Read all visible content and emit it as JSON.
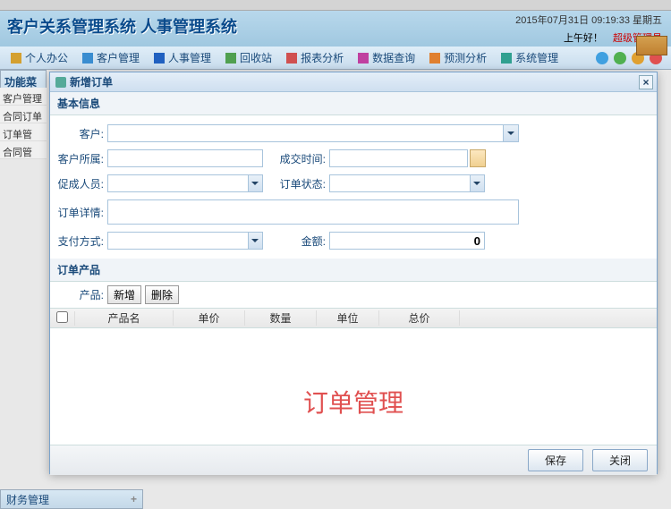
{
  "header": {
    "title": "客户关系管理系统 人事管理系统",
    "datetime": "2015年07月31日 09:19:33 星期五",
    "greeting": "上午好！",
    "admin": "超级管理员"
  },
  "menu": [
    {
      "label": "个人办公",
      "color": "#d4a030"
    },
    {
      "label": "客户管理",
      "color": "#3a8dd0"
    },
    {
      "label": "人事管理",
      "color": "#2060c0"
    },
    {
      "label": "回收站",
      "color": "#50a050"
    },
    {
      "label": "报表分析",
      "color": "#d05050"
    },
    {
      "label": "数据查询",
      "color": "#c040a0"
    },
    {
      "label": "预测分析",
      "color": "#e08030"
    },
    {
      "label": "系统管理",
      "color": "#30a090"
    }
  ],
  "sidebar": {
    "title": "功能菜单",
    "items": [
      "客户管理",
      "合同订单",
      "订单管",
      "合同管"
    ],
    "bottom": "财务管理"
  },
  "dialog": {
    "title": "新增订单",
    "section_basic": "基本信息",
    "labels": {
      "customer": "客户:",
      "belong": "客户所属:",
      "dealtime": "成交时间:",
      "facilitator": "促成人员:",
      "status": "订单状态:",
      "detail": "订单详情:",
      "paytype": "支付方式:",
      "amount": "金额:"
    },
    "amount_value": "0",
    "section_prod": "订单产品",
    "prod_label": "产品:",
    "btn_add": "新增",
    "btn_del": "删除",
    "grid_cols": [
      "产品名",
      "单价",
      "数量",
      "单位",
      "总价"
    ],
    "watermark": "订单管理",
    "btn_save": "保存",
    "btn_close": "关闭"
  }
}
